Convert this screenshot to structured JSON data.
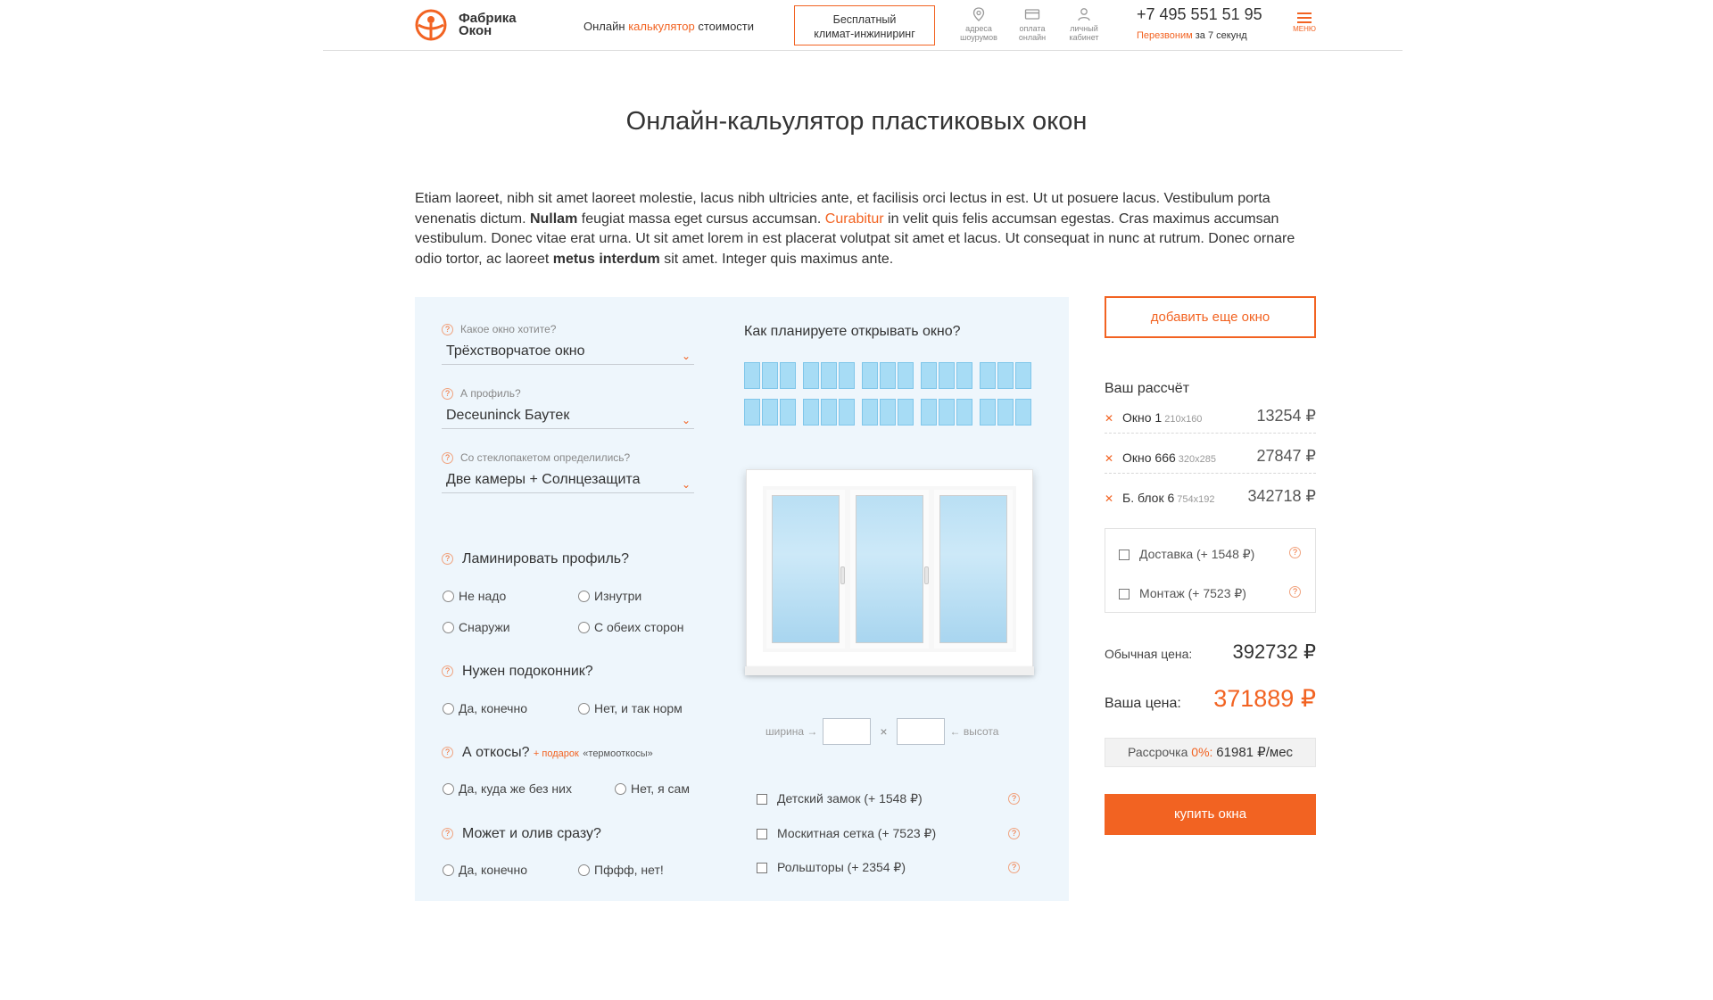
{
  "header": {
    "logo_line1": "Фабрика",
    "logo_line2": "Окон",
    "calc_prefix": "Онлайн",
    "calc_accent": "калькулятор",
    "calc_suffix": "стоимости",
    "climate_line1": "Бесплатный",
    "climate_line2": "климат-инжиниринг",
    "icons": [
      {
        "icon": "map-pin-icon",
        "line1": "адреса",
        "line2": "шоурумов"
      },
      {
        "icon": "credit-card-icon",
        "line1": "оплата",
        "line2": "онлайн"
      },
      {
        "icon": "user-icon",
        "line1": "личный",
        "line2": "кабинет"
      }
    ],
    "phone": "+7 495 551 51 95",
    "callback_accent": "Перезвоним",
    "callback_rest": "за 7 секунд",
    "menu_label": "МЕНЮ"
  },
  "page": {
    "title": "Онлайн-кальулятор пластиковых окон",
    "intro": {
      "p1": "Etiam laoreet, nibh sit amet laoreet molestie, lacus nibh ultricies ante, et facilisis orci lectus in est. Ut ut posuere lacus. Vestibulum porta venenatis dictum. ",
      "b1": "Nullam",
      "p2": " feugiat massa eget cursus accumsan. ",
      "link": "Curabitur",
      "p3": " in velit quis felis accumsan egestas. Cras maximus accumsan vestibulum. Donec vitae erat urna. Ut sit amet lorem in est placerat volutpat sit amet et lacus. Ut consequat in nunc at rutrum. Donec ornare odio tortor, ac laoreet ",
      "b2": "metus interdum",
      "p4": " sit amet. Integer quis maximus ante."
    }
  },
  "calc": {
    "window_type": {
      "label": "Какое окно хотите?",
      "value": "Трёхстворчатое окно"
    },
    "profile": {
      "label": "А профиль?",
      "value": "Deceuninck Баутек"
    },
    "glass": {
      "label": "Со стеклопакетом определились?",
      "value": "Две камеры + Солнцезащита"
    },
    "laminate": {
      "title": "Ламинировать профиль?",
      "options": [
        "Не надо",
        "Изнутри",
        "Снаружи",
        "С обеих сторон"
      ]
    },
    "sill": {
      "title": "Нужен подоконник?",
      "options": [
        "Да, конечно",
        "Нет, и так норм"
      ]
    },
    "slopes": {
      "title": "А откосы?",
      "gift": "+ подарок",
      "gift_text": "«термооткосы»",
      "options": [
        "Да, куда же без них",
        "Нет, я сам"
      ]
    },
    "drain": {
      "title": "Может и олив сразу?",
      "options": [
        "Да, конечно",
        "Пффф, нет!"
      ]
    },
    "opening_title": "Как планируете открывать окно?",
    "sash_variants": 10,
    "dims": {
      "width_label": "ширина →",
      "height_label": "← высота",
      "times": "×"
    },
    "addons": [
      "Детский замок (+ 1548 ₽)",
      "Москитная сетка (+ 7523 ₽)",
      "Рольшторы (+ 2354 ₽)"
    ]
  },
  "summary": {
    "add_button": "добавить еще окно",
    "title": "Ваш рассчёт",
    "items": [
      {
        "name": "Окно 1",
        "size": "210x160",
        "price": "13254 ₽"
      },
      {
        "name": "Окно 666",
        "size": "320x285",
        "price": "27847 ₽"
      },
      {
        "name": "Б. блок 6",
        "size": "754x192",
        "price": "342718 ₽"
      }
    ],
    "extras": [
      "Доставка (+ 1548 ₽)",
      "Монтаж (+ 7523 ₽)"
    ],
    "regular_label": "Обычная цена:",
    "regular_price": "392732 ₽",
    "your_label": "Ваша цена:",
    "your_price": "371889 ₽",
    "credit_label": "Рассрочка",
    "credit_rate": "0%:",
    "credit_value": "61981 ₽/мес",
    "buy_button": "купить окна"
  },
  "colors": {
    "accent": "#f26322",
    "panel": "#eef6fc",
    "glass": "#a7dcf5"
  }
}
